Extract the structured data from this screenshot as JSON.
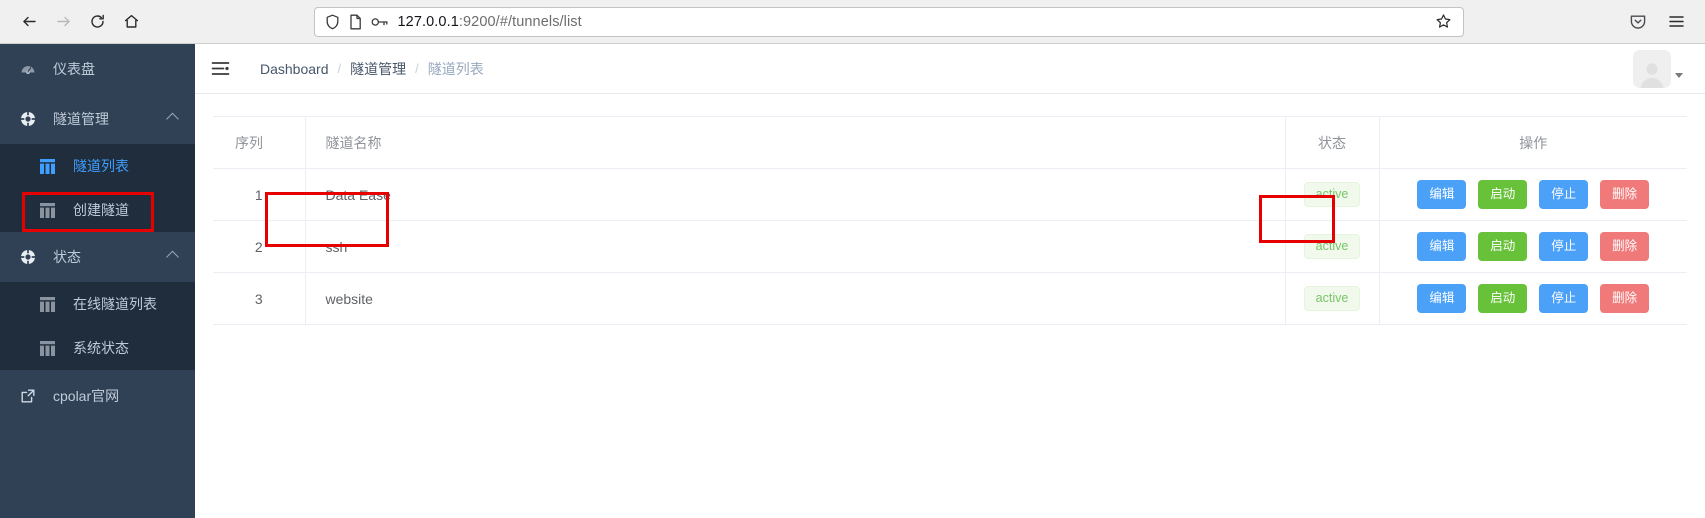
{
  "browser": {
    "back_icon": "back-arrow-icon",
    "forward_icon": "forward-arrow-icon",
    "reload_icon": "reload-icon",
    "home_icon": "home-icon",
    "shield_icon": "shield-icon",
    "page_icon": "page-icon",
    "permission_icon": "key-icon",
    "url_host": "127.0.0.1",
    "url_rest": ":9200/#/tunnels/list",
    "url_full": "127.0.0.1:9200/#/tunnels/list",
    "bookmark_icon": "star-icon",
    "pocket_icon": "pocket-icon",
    "menu_icon": "hamburger-menu-icon"
  },
  "sidebar": {
    "bg_color": "#304156",
    "submenu_bg_color": "#1f2d3d",
    "active_color": "#409eff",
    "items": [
      {
        "label": "仪表盘",
        "icon": "dashboard-gauge-icon",
        "type": "item"
      },
      {
        "label": "隧道管理",
        "icon": "tunnel-circle-icon",
        "type": "group",
        "expanded": true
      },
      {
        "label": "隧道列表",
        "icon": "table-grid-icon",
        "type": "sub",
        "active": true
      },
      {
        "label": "创建隧道",
        "icon": "table-grid-icon",
        "type": "sub",
        "active": false
      },
      {
        "label": "状态",
        "icon": "status-circle-icon",
        "type": "group",
        "expanded": true
      },
      {
        "label": "在线隧道列表",
        "icon": "table-grid-icon",
        "type": "sub",
        "active": false
      },
      {
        "label": "系统状态",
        "icon": "table-grid-icon",
        "type": "sub",
        "active": false
      },
      {
        "label": "cpolar官网",
        "icon": "external-link-icon",
        "type": "item"
      }
    ]
  },
  "navbar": {
    "hamburger_icon": "collapse-menu-icon",
    "breadcrumb": [
      {
        "label": "Dashboard",
        "current": false
      },
      {
        "label": "隧道管理",
        "current": false
      },
      {
        "label": "隧道列表",
        "current": true
      }
    ],
    "separator": "/",
    "avatar_icon": "user-avatar-icon",
    "caret_icon": "caret-down-icon"
  },
  "table": {
    "columns": {
      "seq": "序列",
      "name": "隧道名称",
      "status": "状态",
      "ops": "操作"
    },
    "buttons": {
      "edit": "编辑",
      "start": "启动",
      "stop": "停止",
      "delete": "删除"
    },
    "button_colors": {
      "edit": "#4ba1f7",
      "start": "#67c23a",
      "stop": "#4ba1f7",
      "delete": "#f07a7a"
    },
    "badge_colors": {
      "bg": "#f0f9eb",
      "text": "#79c46a"
    },
    "rows": [
      {
        "seq": "1",
        "name": "Data Ease",
        "status": "active"
      },
      {
        "seq": "2",
        "name": "ssh",
        "status": "active"
      },
      {
        "seq": "3",
        "name": "website",
        "status": "active"
      }
    ]
  },
  "annotations": {
    "color": "#e60000",
    "boxes": [
      "sidebar-tunnel-list",
      "row1-tunnel-name",
      "row1-edit-button"
    ]
  }
}
